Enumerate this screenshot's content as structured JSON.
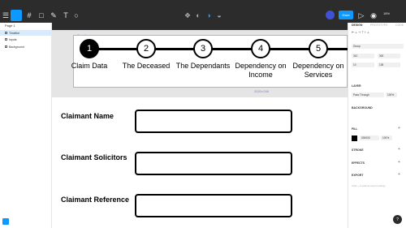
{
  "toolbar": {
    "share_label": "Share",
    "zoom_label": "18%",
    "icons": [
      "menu-icon",
      "move-icon",
      "frame-icon",
      "shape-icon",
      "pen-icon",
      "text-icon",
      "comment-icon"
    ]
  },
  "left_panel": {
    "page_label": "Page 1",
    "layers": [
      "Timeline",
      "Inputs",
      "Background"
    ]
  },
  "canvas": {
    "frame_label": "Timeline",
    "frame_dim": "2020×248",
    "steps": [
      {
        "number": "1",
        "label": "Claim Data"
      },
      {
        "number": "2",
        "label": "The Deceased"
      },
      {
        "number": "3",
        "label": "The Dependants"
      },
      {
        "number": "4",
        "label": "Dependency on Income"
      },
      {
        "number": "5",
        "label": "Dependency on Services"
      }
    ],
    "fields": [
      "Claimant Name",
      "Claimant Solicitors",
      "Claimant Reference"
    ]
  },
  "right_panel": {
    "tabs": [
      "DESIGN",
      "PROTOTYPE",
      "CODE"
    ],
    "group_label": "Group",
    "x_value": "310",
    "y_value": "300",
    "w_value": "10",
    "h_value": "135",
    "layer_label": "LAYER",
    "blend_value": "Pass Through",
    "opacity_value": "100%",
    "background_label": "BACKGROUND",
    "fill_label": "FILL",
    "fill_hex": "000000",
    "fill_opacity": "100%",
    "stroke_label": "STROKE",
    "effects_label": "EFFECTS",
    "export_label": "EXPORT",
    "export_hint": "Click + to add an export setting"
  },
  "colors": {
    "accent": "#0d99ff",
    "selection": "#7c7cdd"
  }
}
